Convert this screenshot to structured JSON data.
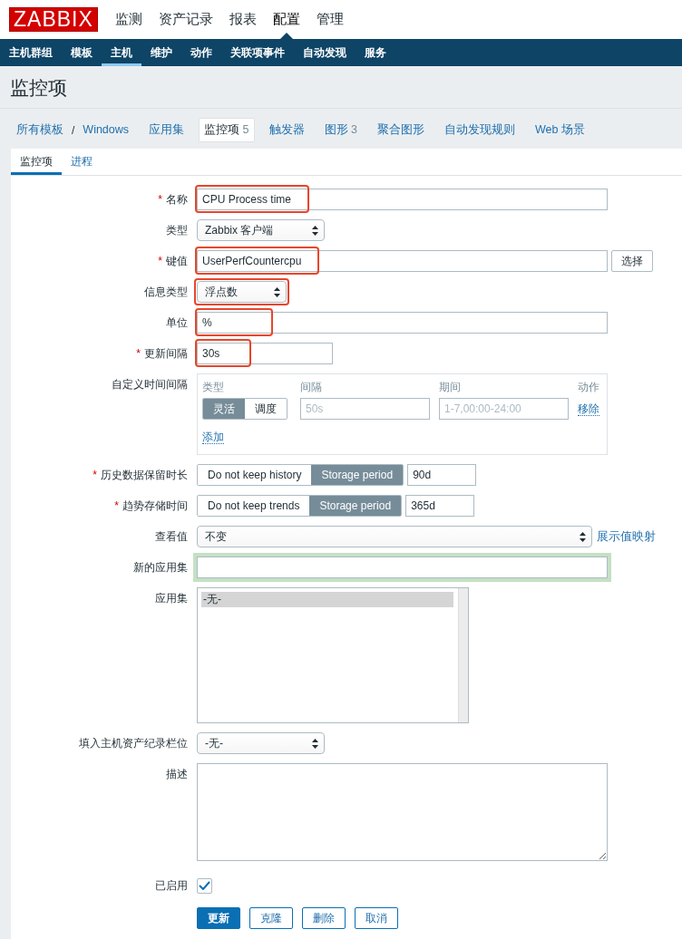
{
  "logo": "ZABBIX",
  "main_menu": [
    {
      "label": "监测",
      "selected": false
    },
    {
      "label": "资产记录",
      "selected": false
    },
    {
      "label": "报表",
      "selected": false
    },
    {
      "label": "配置",
      "selected": true
    },
    {
      "label": "管理",
      "selected": false
    }
  ],
  "sub_menu": [
    {
      "label": "主机群组",
      "selected": false
    },
    {
      "label": "模板",
      "selected": false
    },
    {
      "label": "主机",
      "selected": true
    },
    {
      "label": "维护",
      "selected": false
    },
    {
      "label": "动作",
      "selected": false
    },
    {
      "label": "关联项事件",
      "selected": false
    },
    {
      "label": "自动发现",
      "selected": false
    },
    {
      "label": "服务",
      "selected": false
    }
  ],
  "page_title": "监控项",
  "breadcrumbs": [
    "所有模板",
    "Windows"
  ],
  "breadcrumb_separator": "/",
  "object_tabs": [
    {
      "label": "应用集",
      "selected": false
    },
    {
      "label": "监控项",
      "count": "5",
      "selected": true
    },
    {
      "label": "触发器",
      "selected": false
    },
    {
      "label": "图形",
      "count": "3",
      "selected": false
    },
    {
      "label": "聚合图形",
      "selected": false
    },
    {
      "label": "自动发现规则",
      "selected": false
    },
    {
      "label": "Web 场景",
      "selected": false
    }
  ],
  "form_tabs": [
    {
      "label": "监控项",
      "selected": true
    },
    {
      "label": "进程",
      "selected": false
    }
  ],
  "fields": [
    {
      "kind": "text",
      "required_mark": "*",
      "label": "名称",
      "value": "CPU Process time",
      "highlighted": true
    },
    {
      "kind": "select",
      "label": "类型",
      "value": "Zabbix 客户端"
    },
    {
      "kind": "text_button",
      "required_mark": "*",
      "label": "键值",
      "value": "UserPerfCountercpu",
      "button": "选择",
      "highlighted": true
    },
    {
      "kind": "select",
      "label": "信息类型",
      "value": "浮点数",
      "highlighted": true
    },
    {
      "kind": "text",
      "label": "单位",
      "value": "%",
      "highlighted": true
    },
    {
      "kind": "text",
      "required_mark": "*",
      "label": "更新间隔",
      "value": "30s",
      "highlighted": true
    },
    {
      "kind": "intervals",
      "label": "自定义时间间隔",
      "headers": [
        "类型",
        "间隔",
        "期间",
        "动作"
      ],
      "rows": [
        {
          "modes": [
            {
              "label": "灵活",
              "selected": true
            },
            {
              "label": "调度",
              "selected": false
            }
          ],
          "interval_placeholder": "50s",
          "period_placeholder": "1-7,00:00-24:00",
          "action": "移除"
        }
      ],
      "add": "添加"
    },
    {
      "kind": "storage",
      "required_mark": "*",
      "label": "历史数据保留时长",
      "options": [
        {
          "label": "Do not keep history",
          "selected": false
        },
        {
          "label": "Storage period",
          "selected": true
        }
      ],
      "value": "90d"
    },
    {
      "kind": "storage",
      "required_mark": "*",
      "label": "趋势存储时间",
      "options": [
        {
          "label": "Do not keep trends",
          "selected": false
        },
        {
          "label": "Storage period",
          "selected": true
        }
      ],
      "value": "365d"
    },
    {
      "kind": "select_link",
      "label": "查看值",
      "value": "不变",
      "link": "展示值映射"
    },
    {
      "kind": "text",
      "label": "新的应用集",
      "focused": true
    },
    {
      "kind": "list",
      "label": "应用集",
      "items": [
        {
          "label": "-无-",
          "selected": true
        }
      ]
    },
    {
      "kind": "select",
      "label": "填入主机资产纪录栏位",
      "value": "-无-"
    },
    {
      "kind": "textarea",
      "label": "描述"
    },
    {
      "kind": "checkbox",
      "label": "已启用",
      "checked": true
    }
  ],
  "buttons": [
    {
      "label": "更新",
      "kind": "primary"
    },
    {
      "label": "克隆",
      "kind": "secondary"
    },
    {
      "label": "删除",
      "kind": "secondary"
    },
    {
      "label": "取消",
      "kind": "secondary"
    }
  ]
}
